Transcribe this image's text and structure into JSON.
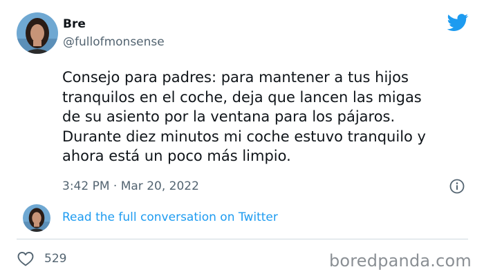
{
  "tweet": {
    "author_name": "Bre",
    "author_handle": "@fullofmonsense",
    "text_lines": [
      "Consejo para padres: para mantener a tus hijos",
      "tranquilos en el coche, deja que lancen las migas",
      "de su asiento por la ventana para los pájaros.",
      "Durante diez minutos mi coche estuvo tranquilo y",
      "ahora está un poco más limpio."
    ],
    "timestamp": "3:42 PM · Mar 20, 2022",
    "read_more_label": "Read the full conversation on Twitter",
    "like_count": "529"
  },
  "icons": {
    "brand": "twitter-bird-icon",
    "info": "info-icon",
    "like": "heart-icon"
  },
  "colors": {
    "accent": "#1d9bf0",
    "text_primary": "#0f1419",
    "text_secondary": "#536471",
    "divider": "#cfd9de"
  },
  "watermark": "boredpanda.com"
}
